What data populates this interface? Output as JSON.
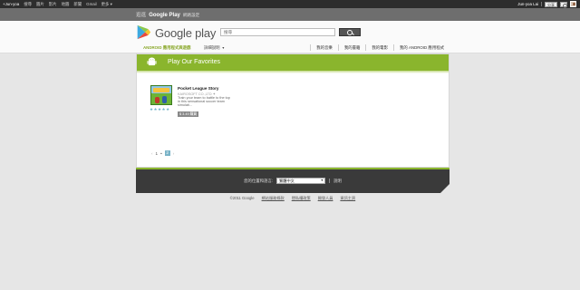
{
  "topbar": {
    "links": [
      "+Jun-yoa",
      "搜尋",
      "圖片",
      "影片",
      "地圖",
      "新聞",
      "Gmail",
      "更多 ▾"
    ],
    "user_name": "Jun-yoa Lai",
    "share_label": "分享"
  },
  "strip": {
    "prefix": "逛逛",
    "store_name": "Google Play",
    "about": "網路設定"
  },
  "header": {
    "logo_text": "Google play",
    "search_placeholder": "搜尋"
  },
  "nav": {
    "apps": "ANDROID 應用程式與遊戲",
    "help": "詳細說明",
    "my_links": [
      "我的音樂",
      "我的書籍",
      "我的電影",
      "我的 ANDROID 應用程式"
    ]
  },
  "banner": {
    "title": "Play Our Favorites",
    "color": "#8ab52d"
  },
  "app": {
    "name": "Pocket League Story",
    "developer": "KAIROSOFT CO.,LTD ✦",
    "description": "Train your team to battle to the top in this sensational soccer team simulati...",
    "price": "$ 3.49 購買",
    "stars": "★★★★★"
  },
  "pager": {
    "prev": "‹",
    "page1": "1",
    "dot": "•",
    "page2": "2",
    "next": "›"
  },
  "footer": {
    "language_label": "您的位置和語言:",
    "language_value": "繁體中文",
    "help": "說明"
  },
  "bottom": {
    "copyright": "©2011 Google",
    "links": [
      "網站服務條款",
      "隱私權政策",
      "開發人員",
      "資訊主頁"
    ]
  }
}
